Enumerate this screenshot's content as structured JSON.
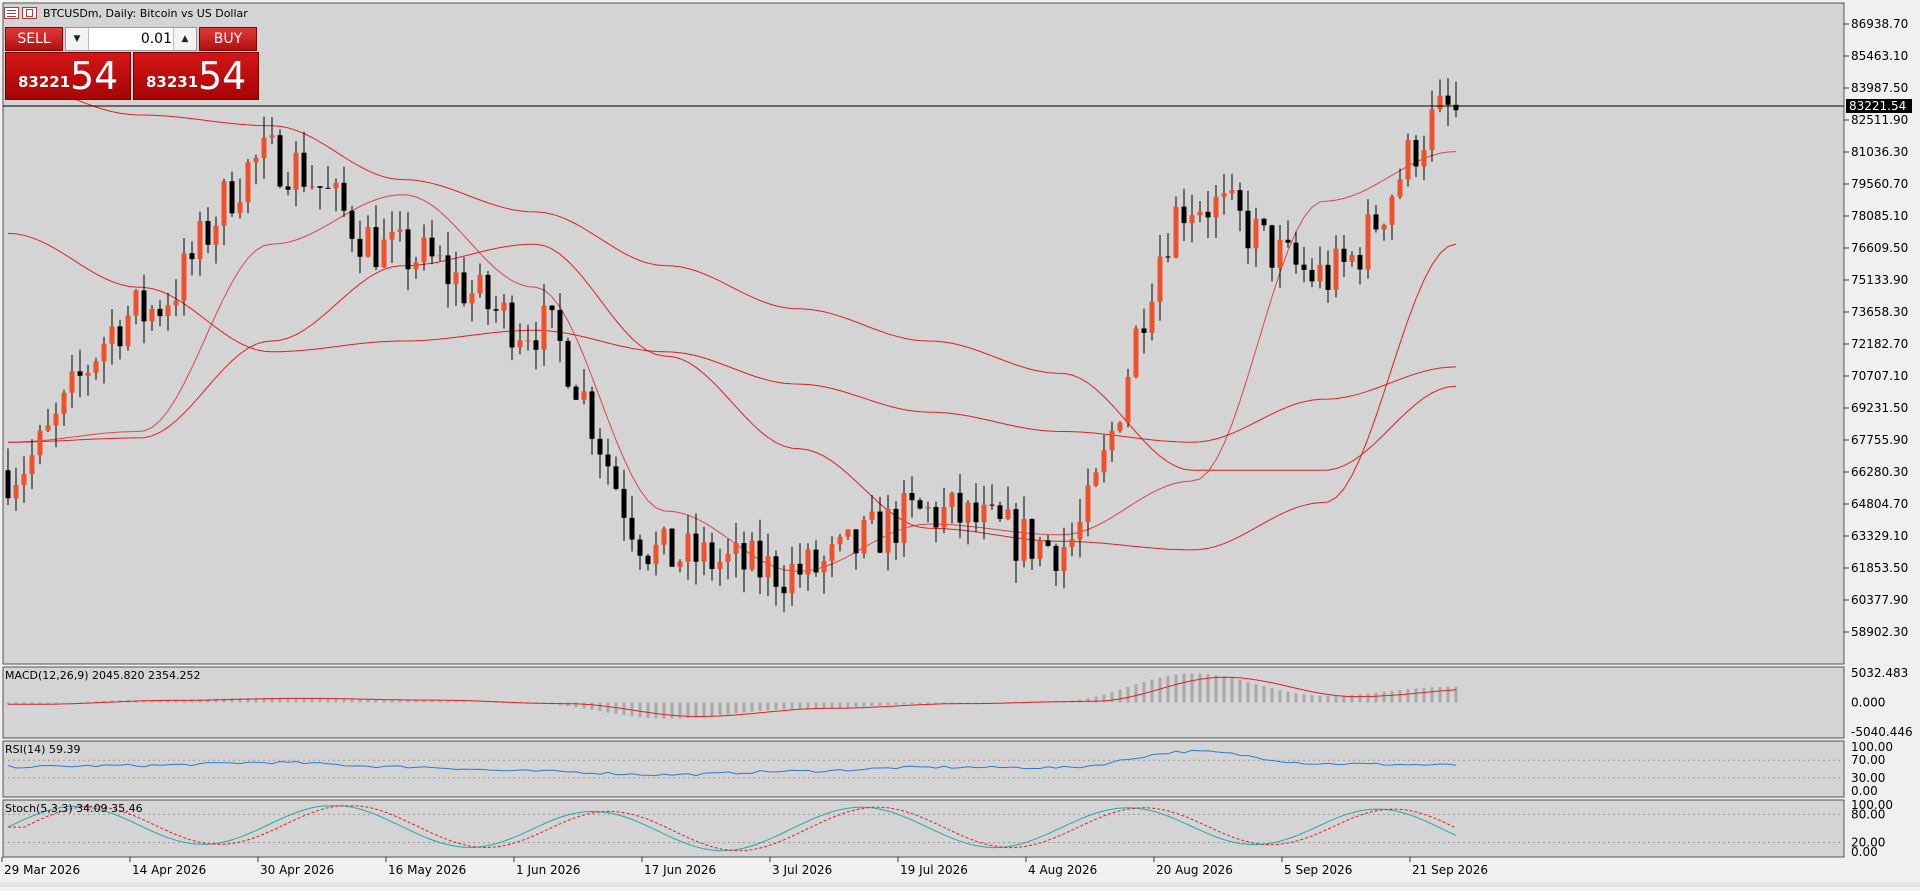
{
  "window": {
    "title": "BTCUSDm, Daily:  Bitcoin vs US Dollar",
    "icons": [
      "chart-window-icon",
      "chart-restore-icon"
    ]
  },
  "trade_panel": {
    "sell_label": "SELL",
    "buy_label": "BUY",
    "lot_value": "0.01",
    "sell_price_prefix": "83221",
    "sell_price_big": "54",
    "buy_price_prefix": "83231",
    "buy_price_big": "54"
  },
  "colors": {
    "chart_bg": "#d4d4d4",
    "bull_candle": "#f0502a",
    "bear_candle": "#000000",
    "ma_line": "#e02020",
    "rsi_line": "#2a7bd6",
    "stoch_main": "#24a8a8",
    "stoch_signal": "#e02020",
    "histogram": "#a8a8a8"
  },
  "price_axis": {
    "labels": [
      "86938.70",
      "85463.10",
      "83987.50",
      "82511.90",
      "81036.30",
      "79560.70",
      "78085.10",
      "76609.50",
      "75133.90",
      "73658.30",
      "72182.70",
      "70707.10",
      "69231.50",
      "67755.90",
      "66280.30",
      "64804.70",
      "63329.10",
      "61853.50",
      "60377.90",
      "58902.30"
    ],
    "current_price": "83221.54"
  },
  "date_axis": {
    "labels": [
      "29 Mar 2026",
      "14 Apr 2026",
      "30 Apr 2026",
      "16 May 2026",
      "1 Jun 2026",
      "17 Jun 2026",
      "3 Jul 2026",
      "19 Jul 2026",
      "4 Aug 2026",
      "20 Aug 2026",
      "5 Sep 2026",
      "21 Sep 2026"
    ]
  },
  "indicators": {
    "macd": {
      "title": "MACD(12,26,9) 2045.820 2354.252",
      "axis_labels": [
        "5032.483",
        "0.000",
        "-5040.446"
      ]
    },
    "rsi": {
      "title": "RSI(14) 59.39",
      "axis_labels": [
        "100.00",
        "70.00",
        "30.00",
        "0.00"
      ]
    },
    "stoch": {
      "title": "Stoch(5,3,3) 34.09 35.46",
      "axis_labels": [
        "100.00",
        "80.00",
        "20.00",
        "0.00"
      ]
    }
  },
  "chart_data": {
    "type": "candlestick",
    "symbol": "BTCUSDm",
    "timeframe": "Daily",
    "ylim": [
      57500,
      88200
    ],
    "x": [
      "29 Mar 2026",
      "14 Apr 2026",
      "30 Apr 2026",
      "16 May 2026",
      "1 Jun 2026",
      "17 Jun 2026",
      "3 Jul 2026",
      "19 Jul 2026",
      "4 Aug 2026",
      "20 Aug 2026",
      "5 Sep 2026",
      "21 Sep 2026"
    ],
    "close_anchors": [
      66500,
      73800,
      81000,
      76500,
      73200,
      62500,
      61800,
      64500,
      63000,
      79000,
      75500,
      83221
    ],
    "moving_averages": [
      {
        "anchors": [
          67800,
          68300,
          77000,
          79300,
          75000,
          64600,
          61800,
          64000,
          63500,
          66000,
          79000,
          81300
        ]
      },
      {
        "anchors": [
          67800,
          68000,
          72500,
          76000,
          77000,
          71800,
          67500,
          63800,
          63200,
          62800,
          65000,
          77000
        ]
      },
      {
        "anchors": [
          77500,
          75000,
          72000,
          72500,
          73000,
          72000,
          70500,
          69200,
          68300,
          67800,
          69800,
          71300
        ]
      },
      {
        "anchors": [
          84500,
          83000,
          82500,
          80000,
          78500,
          76000,
          74000,
          72500,
          71000,
          66500,
          66500,
          70400
        ]
      }
    ],
    "macd": {
      "anchors": [
        -300,
        350,
        700,
        400,
        -200,
        -2400,
        -1000,
        -200,
        200,
        4300,
        1000,
        2354
      ]
    },
    "rsi": {
      "anchors": [
        55,
        58,
        65,
        55,
        45,
        37,
        45,
        54,
        53,
        90,
        62,
        59
      ]
    },
    "stoch": {
      "anchors": [
        60,
        75,
        80,
        70,
        40,
        20,
        50,
        75,
        30,
        90,
        55,
        35
      ]
    }
  }
}
